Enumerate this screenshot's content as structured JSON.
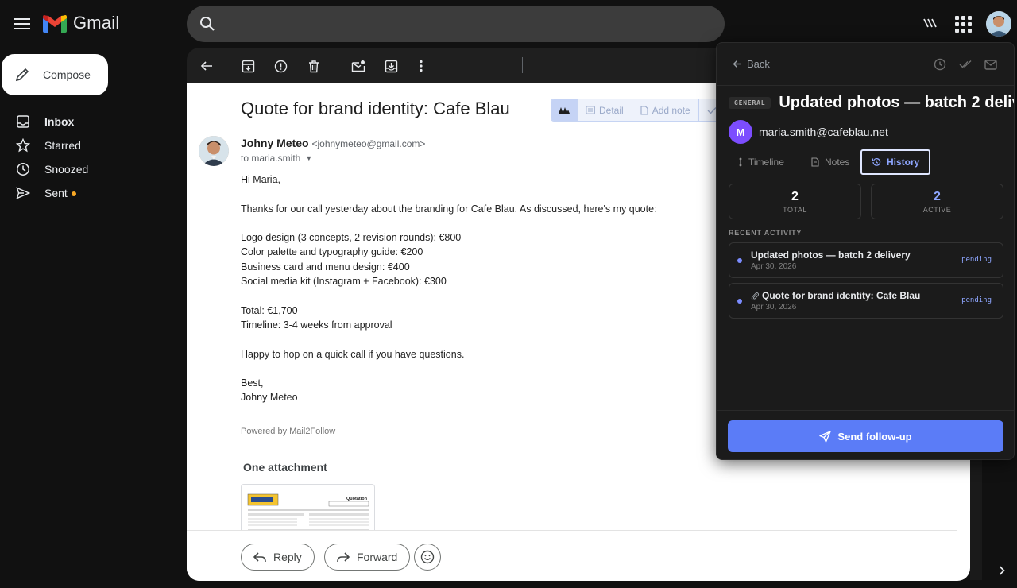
{
  "app": {
    "name": "Gmail",
    "brand_colors": {
      "red": "#ea4335",
      "blue": "#4285f4",
      "green": "#34a853",
      "yellow": "#fbbc04"
    }
  },
  "search": {
    "placeholder": "",
    "value": ""
  },
  "sidebar": {
    "compose_label": "Compose",
    "items": [
      {
        "label": "Inbox",
        "icon": "inbox-icon",
        "active": true
      },
      {
        "label": "Starred",
        "icon": "star-icon"
      },
      {
        "label": "Snoozed",
        "icon": "clock-icon"
      },
      {
        "label": "Sent",
        "icon": "send-icon",
        "indicator_color": "#f9a825"
      }
    ]
  },
  "email": {
    "subject": "Quote for brand identity: Cafe Blau",
    "sender_name": "Johny Meteo",
    "sender_email": "<johnymeteo@gmail.com>",
    "to": "to maria.smith",
    "body": [
      "Hi Maria,",
      "Thanks for our call yesterday about the branding for Cafe Blau. As discussed, here's my quote:",
      "Logo design (3 concepts, 2 revision rounds): €800\nColor palette and typography guide: €200\nBusiness card and menu design: €400\nSocial media kit (Instagram + Facebook): €300",
      "Total: €1,700\nTimeline: 3-4 weeks from approval",
      "Happy to hop on a quick call if you have questions.",
      "Best,\nJohny Meteo"
    ],
    "powered_by": "Powered by Mail2Follow",
    "attachment_title": "One attachment",
    "attachment_preview_title": "Quotation"
  },
  "m2f_toolbar": {
    "detail": "Detail",
    "add_note": "Add note"
  },
  "reply_bar": {
    "reply": "Reply",
    "forward": "Forward"
  },
  "panel": {
    "back": "Back",
    "tag": "GENERAL",
    "title": "Updated photos — batch 2 deliv…",
    "contact_initial": "M",
    "contact_email": "maria.smith@cafeblau.net",
    "tabs": [
      {
        "label": "Timeline"
      },
      {
        "label": "Notes"
      },
      {
        "label": "History",
        "active": true
      }
    ],
    "stats": [
      {
        "value": "2",
        "label": "TOTAL",
        "color": "#ffffff"
      },
      {
        "value": "2",
        "label": "ACTIVE",
        "color": "#8ea6ff"
      }
    ],
    "recent_label": "RECENT ACTIVITY",
    "activities": [
      {
        "title": "Updated photos — batch 2 delivery",
        "date": "Apr 30, 2026",
        "status": "pending",
        "attachment": false
      },
      {
        "title": "Quote for brand identity: Cafe Blau",
        "date": "Apr 30, 2026",
        "status": "pending",
        "attachment": true
      }
    ],
    "send_label": "Send follow-up",
    "accent": "#5b7cf7"
  }
}
